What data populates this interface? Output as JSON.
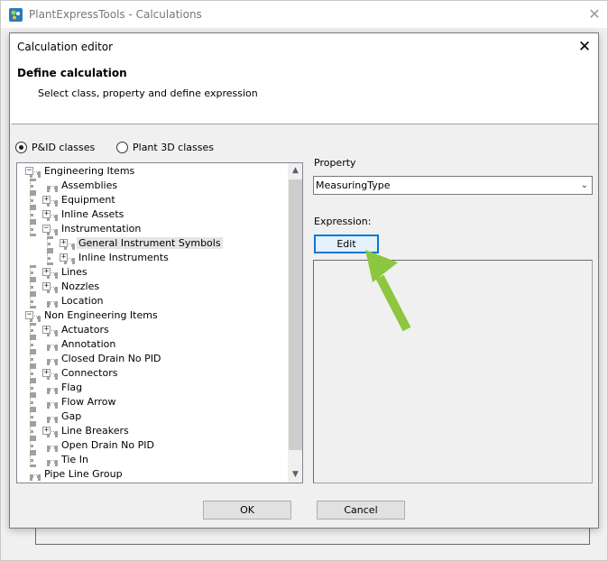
{
  "outer_window": {
    "title": "PlantExpressTools - Calculations",
    "close_glyph": "✕"
  },
  "dialog": {
    "title": "Calculation editor",
    "close_glyph": "✕",
    "header_title": "Define calculation",
    "header_subtitle": "Select class, property and define expression"
  },
  "class_options": [
    {
      "label": "P&ID classes",
      "checked": true
    },
    {
      "label": "Plant 3D classes",
      "checked": false
    }
  ],
  "tree": [
    {
      "label": "Engineering Items",
      "level": 0,
      "expander": "−"
    },
    {
      "label": "Assemblies",
      "level": 1,
      "expander": ""
    },
    {
      "label": "Equipment",
      "level": 1,
      "expander": "+"
    },
    {
      "label": "Inline Assets",
      "level": 1,
      "expander": "+"
    },
    {
      "label": "Instrumentation",
      "level": 1,
      "expander": "−"
    },
    {
      "label": "General Instrument Symbols",
      "level": 2,
      "expander": "+",
      "selected": true
    },
    {
      "label": "Inline Instruments",
      "level": 2,
      "expander": "+"
    },
    {
      "label": "Lines",
      "level": 1,
      "expander": "+"
    },
    {
      "label": "Nozzles",
      "level": 1,
      "expander": "+"
    },
    {
      "label": "Location",
      "level": 1,
      "expander": ""
    },
    {
      "label": "Non Engineering Items",
      "level": 0,
      "expander": "−"
    },
    {
      "label": "Actuators",
      "level": 1,
      "expander": "+"
    },
    {
      "label": "Annotation",
      "level": 1,
      "expander": ""
    },
    {
      "label": "Closed Drain No PID",
      "level": 1,
      "expander": ""
    },
    {
      "label": "Connectors",
      "level": 1,
      "expander": "+"
    },
    {
      "label": "Flag",
      "level": 1,
      "expander": ""
    },
    {
      "label": "Flow Arrow",
      "level": 1,
      "expander": ""
    },
    {
      "label": "Gap",
      "level": 1,
      "expander": ""
    },
    {
      "label": "Line Breakers",
      "level": 1,
      "expander": "+"
    },
    {
      "label": "Open Drain No PID",
      "level": 1,
      "expander": ""
    },
    {
      "label": "Tie In",
      "level": 1,
      "expander": ""
    },
    {
      "label": "Pipe Line Group",
      "level": 0,
      "expander": ""
    }
  ],
  "property": {
    "label": "Property",
    "value": "MeasuringType",
    "chevron": "⌄"
  },
  "expression": {
    "label": "Expression:",
    "edit_label": "Edit"
  },
  "buttons": {
    "ok": "OK",
    "cancel": "Cancel"
  },
  "scroll": {
    "up": "▲",
    "down": "▼"
  },
  "colors": {
    "arrow": "#8dc63f",
    "focus": "#0078d7"
  }
}
